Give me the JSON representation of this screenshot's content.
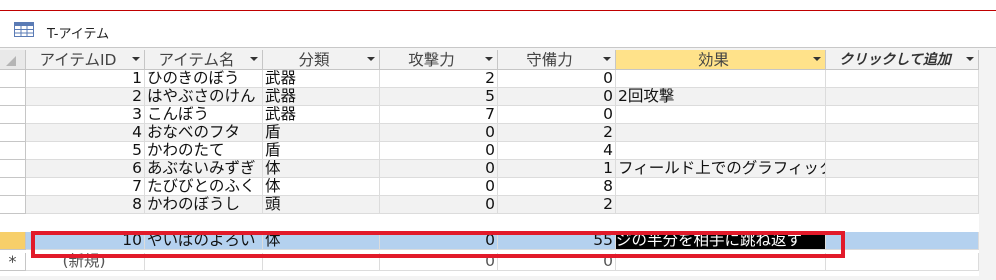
{
  "window": {
    "title": "T-アイテム",
    "table_icon": "table-icon"
  },
  "columns": [
    {
      "label": "アイテムID"
    },
    {
      "label": "アイテム名"
    },
    {
      "label": "分類"
    },
    {
      "label": "攻撃力"
    },
    {
      "label": "守備力"
    },
    {
      "label": "効果"
    },
    {
      "label": "クリックして追加"
    }
  ],
  "rows": [
    {
      "id": "1",
      "name": "ひのきのぼう",
      "category": "武器",
      "attack": "2",
      "defense": "0",
      "effect": ""
    },
    {
      "id": "2",
      "name": "はやぶさのけん",
      "category": "武器",
      "attack": "5",
      "defense": "0",
      "effect": "2回攻撃"
    },
    {
      "id": "3",
      "name": "こんぼう",
      "category": "武器",
      "attack": "7",
      "defense": "0",
      "effect": ""
    },
    {
      "id": "4",
      "name": "おなべのフタ",
      "category": "盾",
      "attack": "0",
      "defense": "2",
      "effect": ""
    },
    {
      "id": "5",
      "name": "かわのたて",
      "category": "盾",
      "attack": "0",
      "defense": "4",
      "effect": ""
    },
    {
      "id": "6",
      "name": "あぶないみずぎ",
      "category": "体",
      "attack": "0",
      "defense": "1",
      "effect": "フィールド上でのグラフィック"
    },
    {
      "id": "7",
      "name": "たびびとのふく",
      "category": "体",
      "attack": "0",
      "defense": "8",
      "effect": ""
    },
    {
      "id": "8",
      "name": "かわのぼうし",
      "category": "頭",
      "attack": "0",
      "defense": "2",
      "effect": ""
    },
    {
      "id": "10",
      "name": "やいばのよろい",
      "category": "体",
      "attack": "0",
      "defense": "55",
      "effect": "ジの半分を相手に跳ね返す"
    }
  ],
  "new_row": {
    "marker": "*",
    "id": "(新規)",
    "attack": "0",
    "defense": "0"
  },
  "colors": {
    "header_bg": "#f2f2f2",
    "effect_header_bg": "#ffe28a",
    "selected_row_bg": "#b4d1ef",
    "row_selector_current": "#f7cf6a",
    "highlight_box": "#e21a2a"
  }
}
